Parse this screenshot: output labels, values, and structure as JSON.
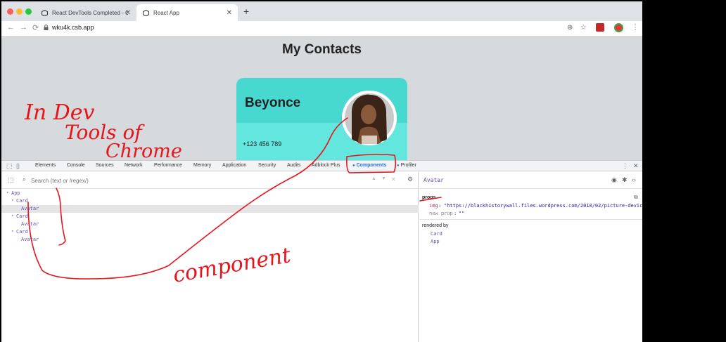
{
  "browser": {
    "tabs": [
      {
        "title": "React DevTools Completed - Co",
        "active": false
      },
      {
        "title": "React App",
        "active": true
      }
    ],
    "new_tab_symbol": "+",
    "url": "wku4k.csb.app"
  },
  "page": {
    "title": "My Contacts",
    "card": {
      "name": "Beyonce",
      "phone": "+123 456 789"
    }
  },
  "devtools": {
    "tabs": [
      "Elements",
      "Console",
      "Sources",
      "Network",
      "Performance",
      "Memory",
      "Application",
      "Security",
      "Audits",
      "Adblock Plus",
      "Components",
      "Profiler"
    ],
    "active_tab": "Components",
    "search_placeholder": "Search (text or /regex/)",
    "tree": [
      {
        "label": "App",
        "depth": 0,
        "caret": "▾",
        "selected": false
      },
      {
        "label": "Card",
        "depth": 1,
        "caret": "▾",
        "selected": false
      },
      {
        "label": "Avatar",
        "depth": 2,
        "caret": "",
        "selected": true
      },
      {
        "label": "Card",
        "depth": 1,
        "caret": "▾",
        "selected": false
      },
      {
        "label": "Avatar",
        "depth": 2,
        "caret": "",
        "selected": false
      },
      {
        "label": "Card",
        "depth": 1,
        "caret": "▾",
        "selected": false
      },
      {
        "label": "Avatar",
        "depth": 2,
        "caret": "",
        "selected": false
      }
    ],
    "inspector": {
      "component_name": "Avatar",
      "props_title": "props",
      "props": [
        {
          "key": "img",
          "value": "\"https://blackhistorywall.files.wordpress.com/2010/02/picture-device-i"
        },
        {
          "key": "new prop",
          "value": "\"\""
        }
      ],
      "rendered_by_title": "rendered by",
      "rendered_by": [
        "Card",
        "App"
      ]
    }
  },
  "annotations": {
    "handwriting": [
      "In Dev",
      "Tools of",
      "Chrome",
      "component"
    ],
    "color": "#e8141c"
  },
  "colors": {
    "card_top": "#47d8d0",
    "card_bottom": "#63e6dd",
    "component_purple": "#6a51b2",
    "active_tab_blue": "#1a73e8"
  }
}
